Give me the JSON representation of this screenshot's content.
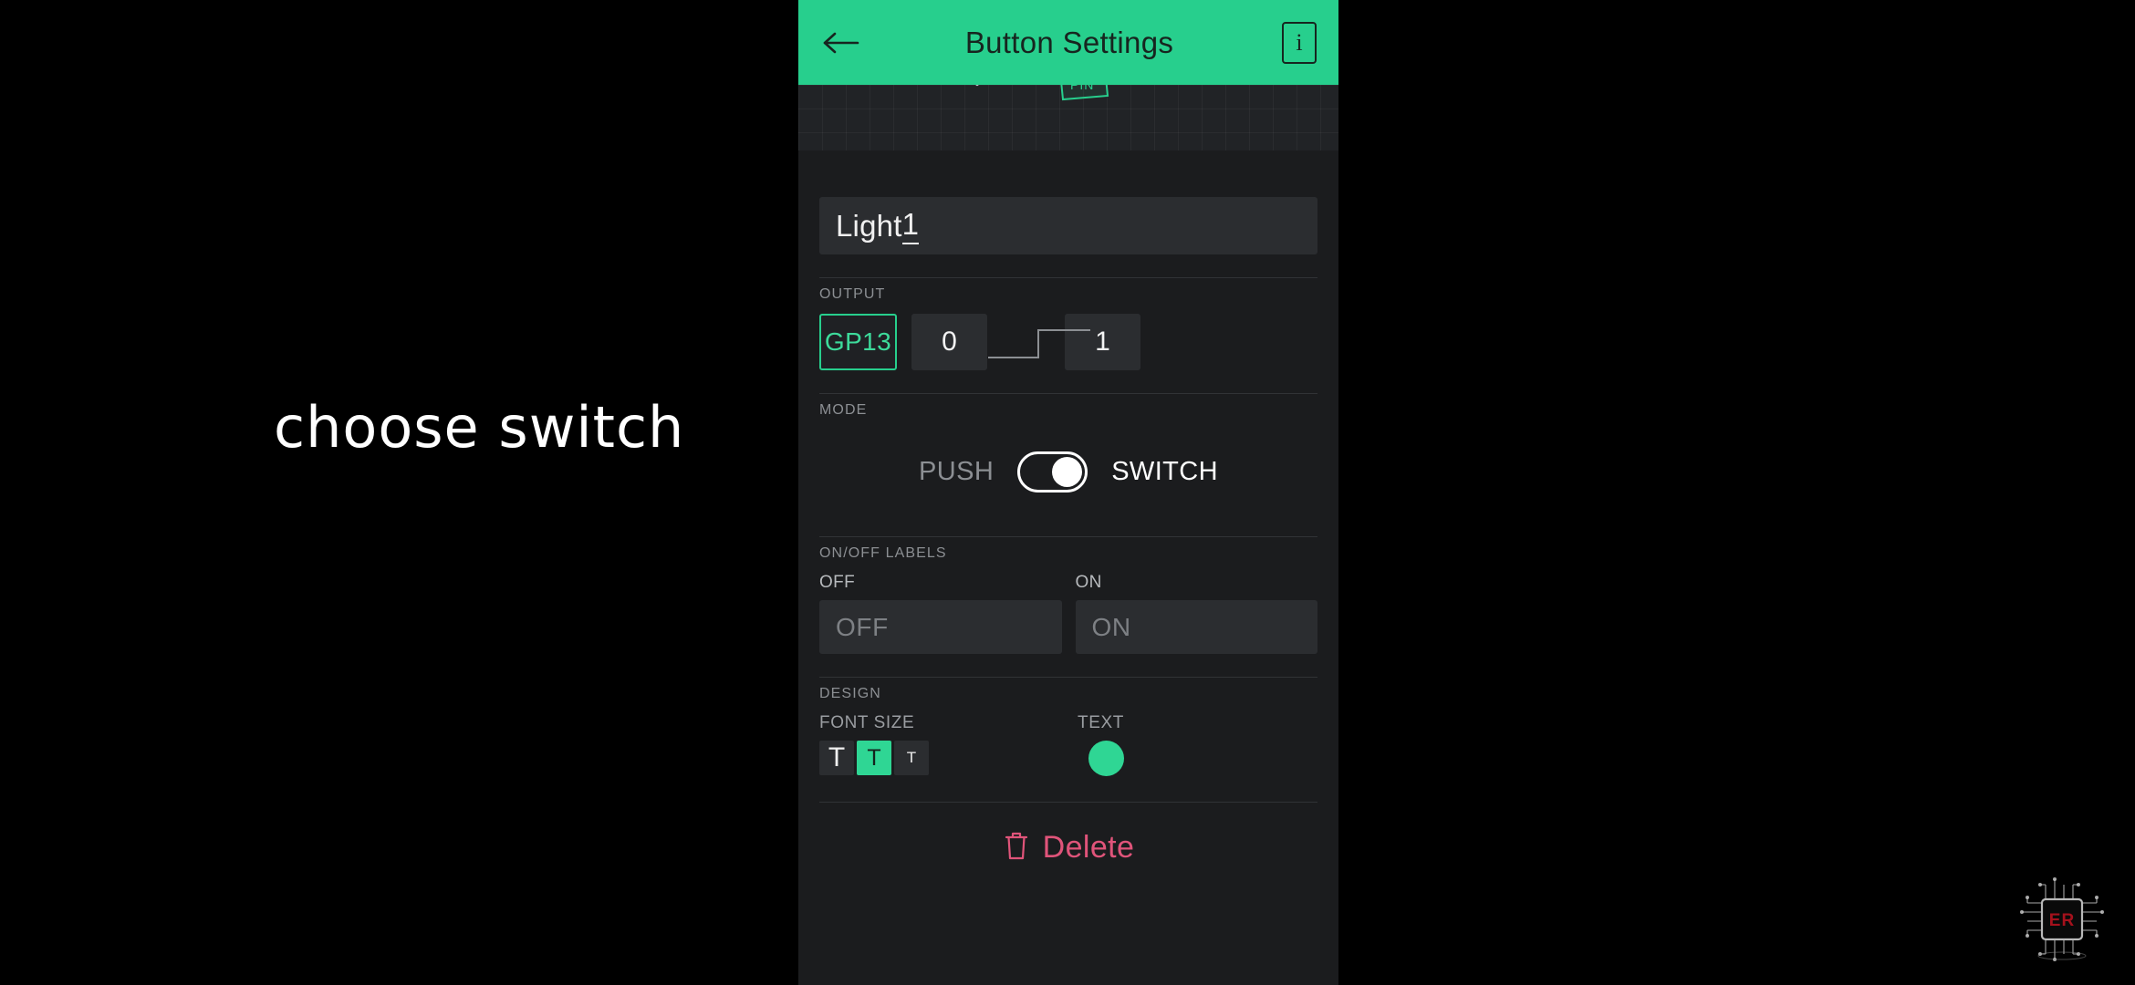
{
  "annotation": {
    "text": "choose switch"
  },
  "appbar": {
    "title": "Button Settings",
    "back_icon": "arrow-left-icon",
    "info_label": "i",
    "bg_color": "#27cf8d",
    "fg_color": "#17251f"
  },
  "illustration": {
    "pin_badge": "PIN"
  },
  "name_field": {
    "value_head": "Light ",
    "value_tail": "1"
  },
  "output": {
    "section_title": "OUTPUT",
    "pin_label": "GP13",
    "low_label": "0",
    "high_label": "1",
    "accent_color": "#27cf8d"
  },
  "mode": {
    "section_title": "MODE",
    "left_label": "PUSH",
    "right_label": "SWITCH",
    "toggle_state": "SWITCH"
  },
  "onoff": {
    "section_title": "ON/OFF LABELS",
    "off_caption": "OFF",
    "off_placeholder": "OFF",
    "off_value": "",
    "on_caption": "ON",
    "on_placeholder": "ON",
    "on_value": ""
  },
  "design": {
    "section_title": "DESIGN",
    "font_size_caption": "FONT SIZE",
    "font_options": [
      "T",
      "T",
      "T"
    ],
    "font_selected_index": 1,
    "text_caption": "TEXT",
    "text_color": "#2fd694"
  },
  "delete": {
    "label": "Delete",
    "color": "#e0547a",
    "icon": "trash-icon"
  },
  "watermark": {
    "chip_label": "ER"
  }
}
